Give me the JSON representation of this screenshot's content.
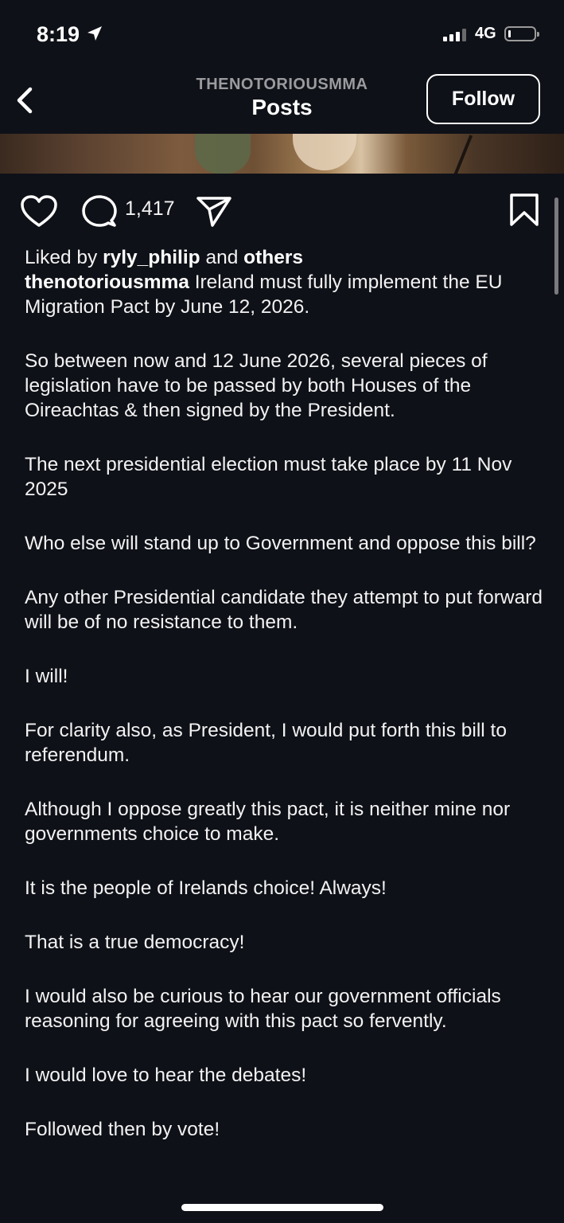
{
  "status_bar": {
    "time": "8:19",
    "network": "4G",
    "icons": [
      "location-arrow-icon",
      "signal-icon",
      "battery-icon"
    ]
  },
  "header": {
    "account": "THENOTORIOUSMMA",
    "title": "Posts",
    "follow_label": "Follow",
    "back_icon": "chevron-left-icon"
  },
  "actions": {
    "like_icon": "heart-icon",
    "comment_icon": "comment-icon",
    "comment_count": "1,417",
    "share_icon": "send-icon",
    "save_icon": "bookmark-icon"
  },
  "post": {
    "liked_prefix": "Liked by",
    "liked_user": "ryly_philip",
    "liked_and": "and",
    "liked_others": "others",
    "author": "thenotoriousmma",
    "paragraphs": [
      "Ireland must fully implement the EU Migration Pact by June 12, 2026.",
      "So between now and 12 June 2026, several pieces of legislation have to be passed by both Houses of the Oireachtas & then signed by the President.",
      "The next presidential election must take place by 11 Nov 2025",
      "Who else will stand up to Government and oppose this bill?",
      "Any other Presidential candidate they attempt to put forward will be of no resistance to them.",
      "I will!",
      "For clarity also, as President, I would put forth this bill to referendum.",
      "Although I oppose greatly this pact, it is neither mine nor governments choice to make.",
      "It is the people of Irelands choice! Always!",
      "That is a true democracy!",
      "I would also be curious to hear our government officials reasoning for agreeing with this pact so fervently.",
      "I would love to hear the debates!",
      "Followed then by vote!"
    ]
  },
  "colors": {
    "background": "#0f1118",
    "text": "#f2f2f2",
    "muted": "#9b9b9f"
  }
}
